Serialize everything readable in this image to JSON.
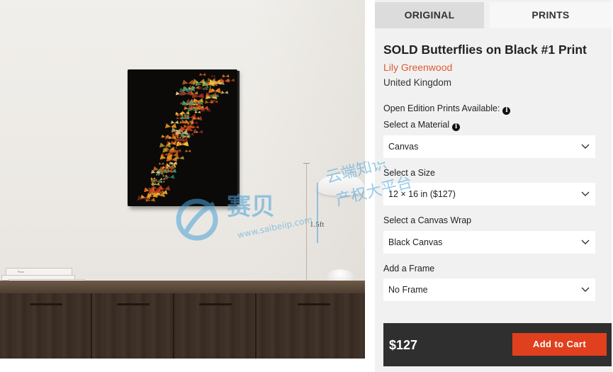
{
  "scene": {
    "measurement_label": "1.5ft",
    "book_spines": [
      "Peace",
      "Inviting Peace"
    ]
  },
  "tabs": [
    {
      "label": "ORIGINAL",
      "active": false
    },
    {
      "label": "PRINTS",
      "active": true
    }
  ],
  "product": {
    "title": "SOLD Butterflies on Black #1 Print",
    "artist": "Lily Greenwood",
    "country": "United Kingdom",
    "open_edition_label": "Open Edition Prints Available:"
  },
  "options": {
    "material": {
      "label": "Select a Material",
      "value": "Canvas"
    },
    "size": {
      "label": "Select a Size",
      "value": "12 × 16 in ($127)"
    },
    "wrap": {
      "label": "Select a Canvas Wrap",
      "value": "Black Canvas"
    },
    "frame": {
      "label": "Add a Frame",
      "value": "No Frame"
    }
  },
  "cart": {
    "price": "$127",
    "button_label": "Add to Cart"
  },
  "watermark": {
    "brand": "赛贝",
    "url": "www.saibeiip.com",
    "tagline_1": "云端知识",
    "tagline_2": "产权大平台"
  },
  "icons": {
    "info": "info-icon",
    "dropdown": "chevron-down-icon"
  },
  "colors": {
    "accent": "#e0401d",
    "artist_link": "#e05a36",
    "cart_bar": "#2f2f2f",
    "watermark": "#4aa3d8"
  }
}
